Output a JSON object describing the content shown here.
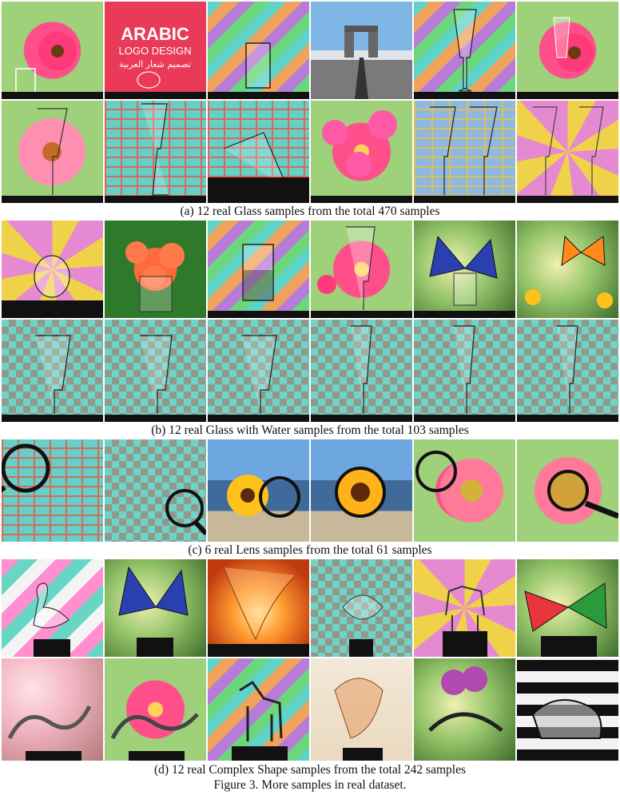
{
  "figure": {
    "caption_a": "(a) 12 real Glass samples from the total 470 samples",
    "caption_b": "(b) 12 real Glass with Water samples from the total 103 samples",
    "caption_c": "(c) 6 real Lens samples from the total 61 samples",
    "caption_d": "(d) 12 real Complex Shape samples from the total 242 samples",
    "figure_caption": "Figure 3. More samples in real dataset.",
    "logo_text": {
      "line1": "ARABIC",
      "line2": "LOGO DESIGN",
      "line3": "تصميم شعار العربية"
    }
  },
  "sections": {
    "glass": [
      [
        "floral-pink",
        "red-logo",
        "stripes-a",
        "sky",
        "stripes-a",
        "floral-pink"
      ],
      [
        "floral-pink",
        "brick",
        "brick",
        "floral-pink",
        "brick-gold",
        "burst"
      ]
    ],
    "glass_water": [
      [
        "burst",
        "floral-red",
        "stripes-a",
        "floral-pink",
        "green-blur",
        "green-blur"
      ],
      [
        "check",
        "check",
        "check",
        "check",
        "check",
        "check"
      ]
    ],
    "lens": [
      [
        "brick",
        "check",
        "lake",
        "lake",
        "floral-pink",
        "floral-pink"
      ]
    ],
    "complex_shape": [
      [
        "stripes-b",
        "green-blur",
        "orange-glow",
        "check",
        "burst",
        "green-blur"
      ],
      [
        "blossom",
        "floral-pink",
        "stripes-a",
        "warm",
        "green-blur",
        "zebra"
      ]
    ]
  }
}
